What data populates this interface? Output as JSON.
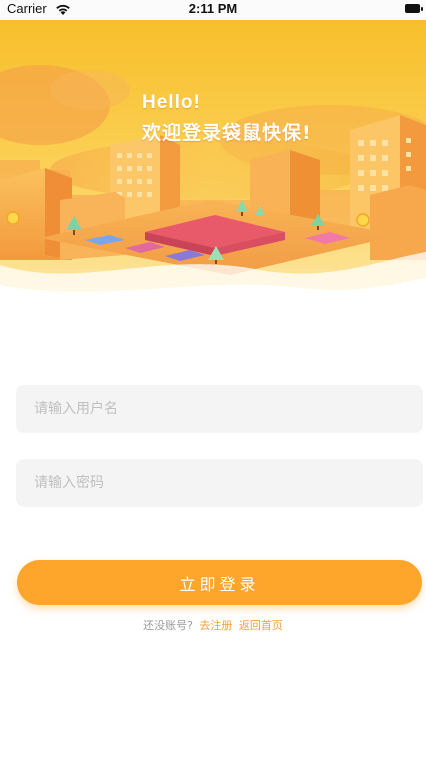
{
  "status_bar": {
    "carrier": "Carrier",
    "time": "2:11 PM",
    "icons": [
      "wifi-icon",
      "battery-icon"
    ]
  },
  "banner": {
    "hello": "Hello!",
    "welcome": "欢迎登录袋鼠快保!",
    "colors": {
      "sky_top": "#f7c32a",
      "sky_bottom": "#fdd86a",
      "building": "#f8a646",
      "ground": "#f6ae52"
    }
  },
  "form": {
    "username_placeholder": "请输入用户名",
    "username_value": "",
    "password_placeholder": "请输入密码",
    "password_value": "",
    "login_label": "立即登录",
    "accent": "#fea52b"
  },
  "footer": {
    "no_account_text": "还没账号?",
    "register_link": "去注册",
    "home_link": "返回首页",
    "link_color": "#f5a037"
  }
}
